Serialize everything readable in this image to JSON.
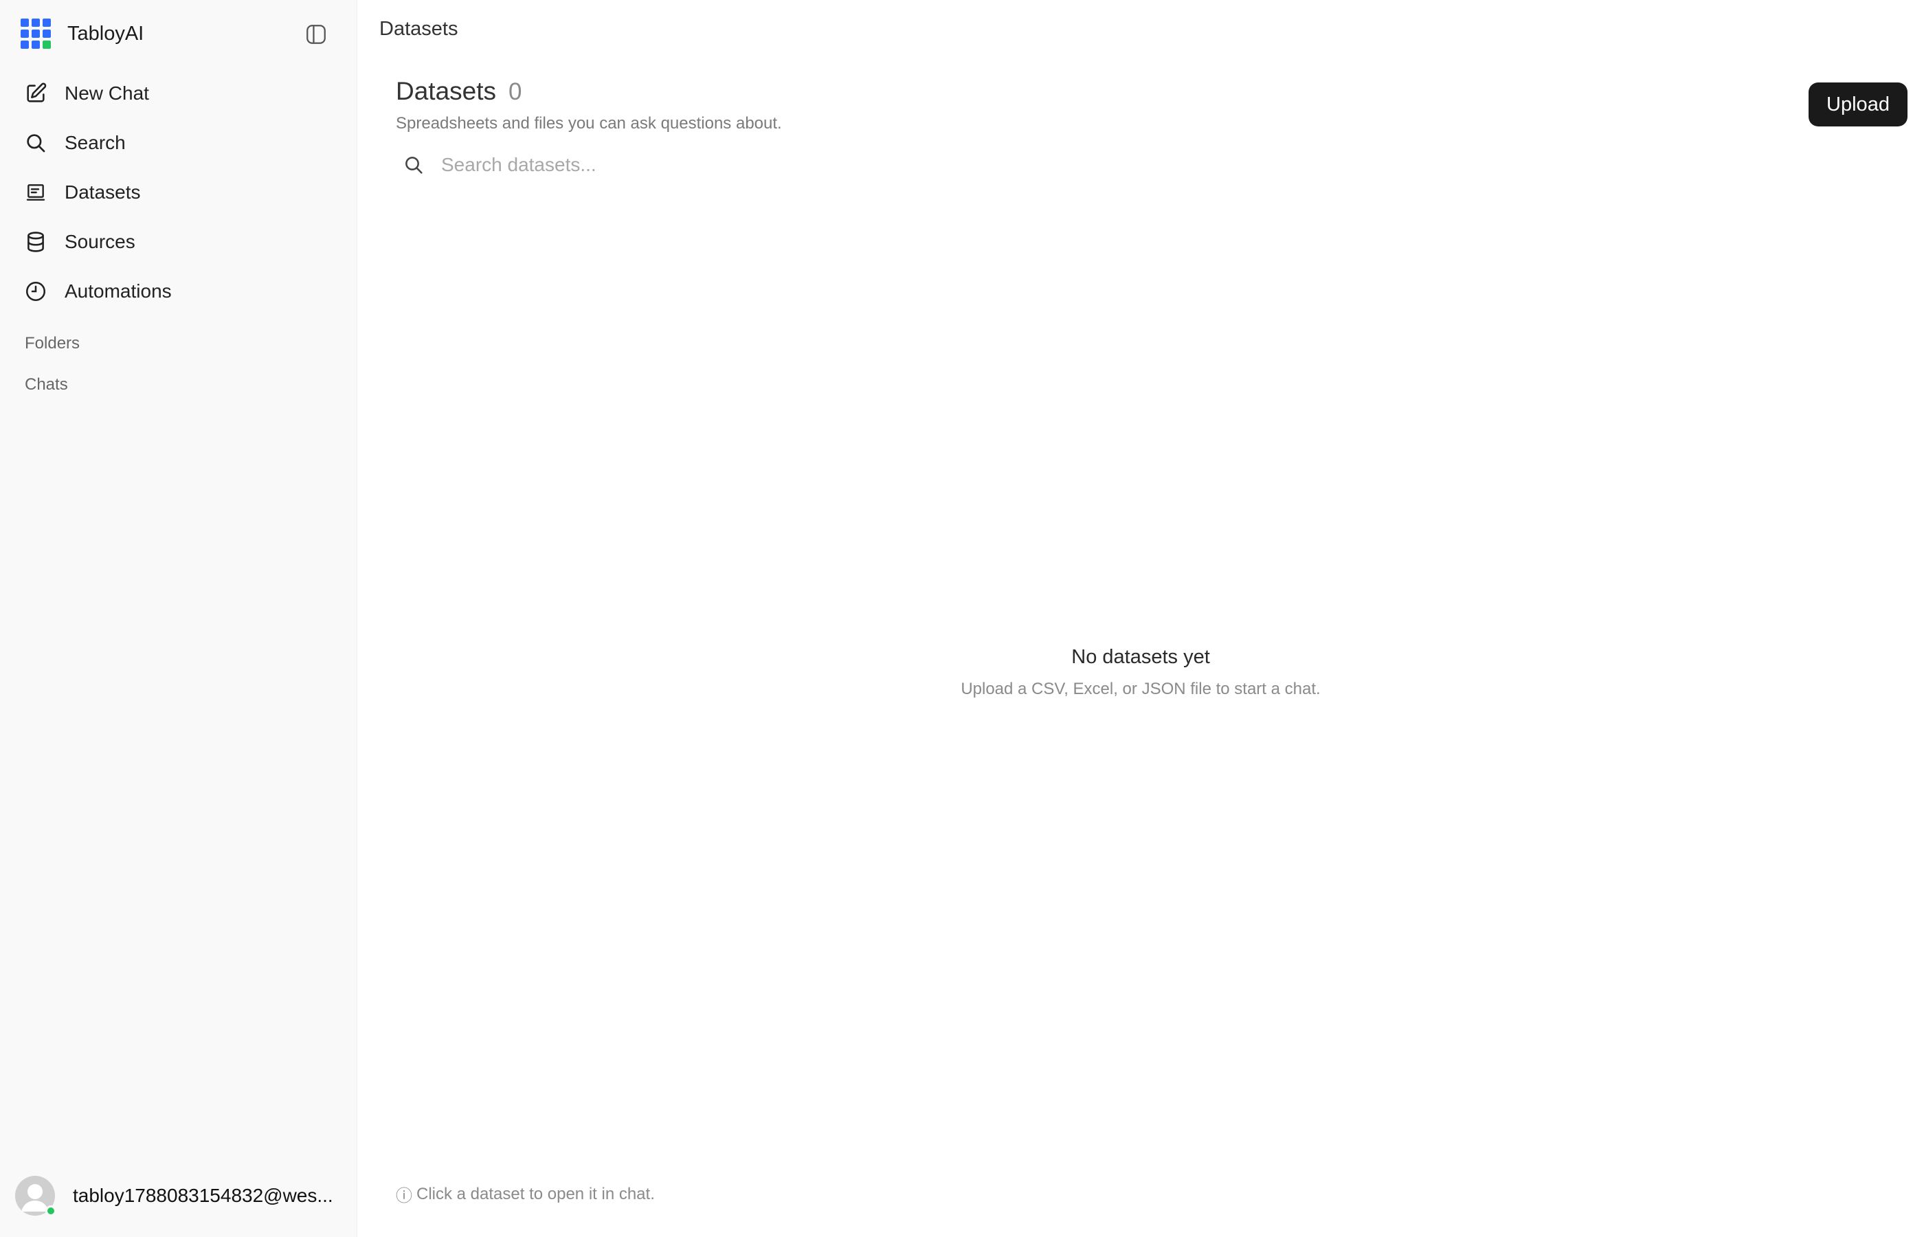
{
  "app": {
    "name": "TabloyAI",
    "accent_color": "#2f6bff",
    "status_color": "#22c55e"
  },
  "sidebar": {
    "items": [
      {
        "label": "New Chat",
        "icon": "pencil-square-icon"
      },
      {
        "label": "Search",
        "icon": "search-icon"
      },
      {
        "label": "Datasets",
        "icon": "datasets-icon"
      },
      {
        "label": "Sources",
        "icon": "database-icon"
      },
      {
        "label": "Automations",
        "icon": "clock-icon"
      }
    ],
    "sections": {
      "folders": "Folders",
      "chats": "Chats"
    },
    "user": {
      "email": "tabloy1788083154832@wes..."
    }
  },
  "topbar": {
    "title": "Datasets"
  },
  "page": {
    "title": "Datasets",
    "count": "0",
    "subtitle": "Spreadsheets and files you can ask questions about.",
    "upload_label": "Upload",
    "search_placeholder": "Search datasets...",
    "empty_title": "No datasets yet",
    "empty_subtitle": "Upload a CSV, Excel, or JSON file to start a chat.",
    "hint_icon": "ⓘ",
    "hint": "Click a dataset to open it in chat."
  }
}
